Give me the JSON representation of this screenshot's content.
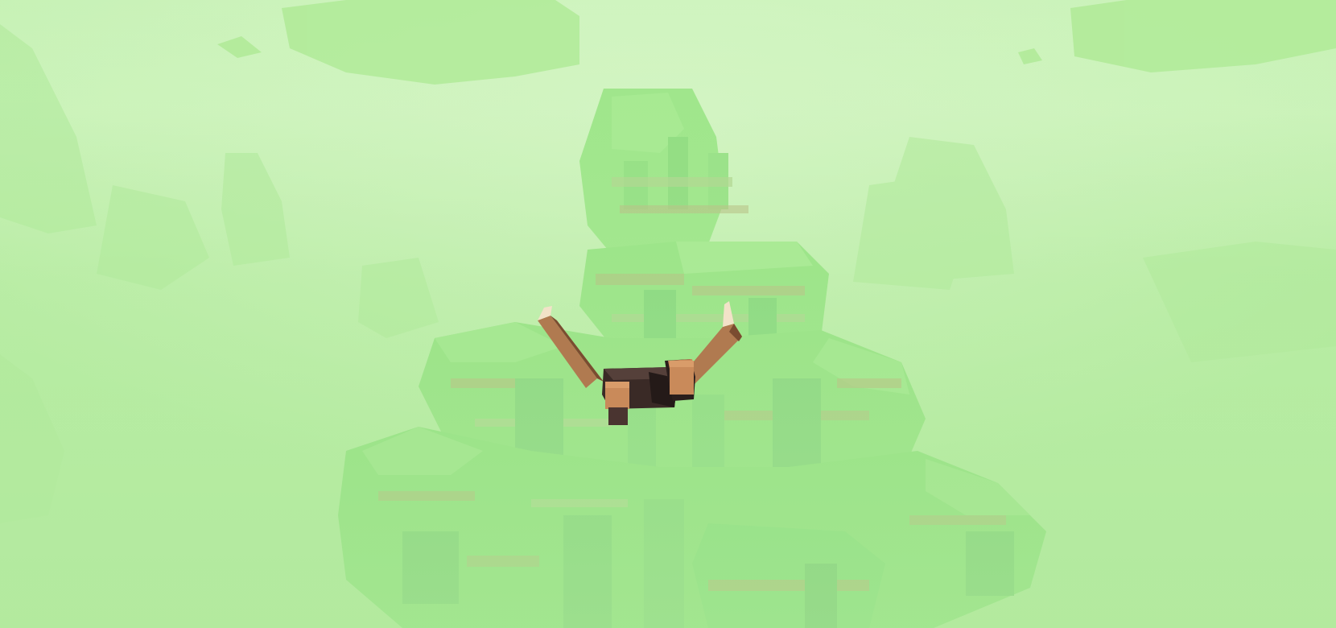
{
  "scene": {
    "kind": "voxel game world",
    "view": "third-person",
    "fog_color": "#c4f0b0",
    "foliage_color": "#6ed86a",
    "earth_color": "#b9915a",
    "player": {
      "state": "gliding",
      "skin_color": "#c98a5a",
      "shirt_color": "#3a2a26"
    },
    "hud": []
  }
}
